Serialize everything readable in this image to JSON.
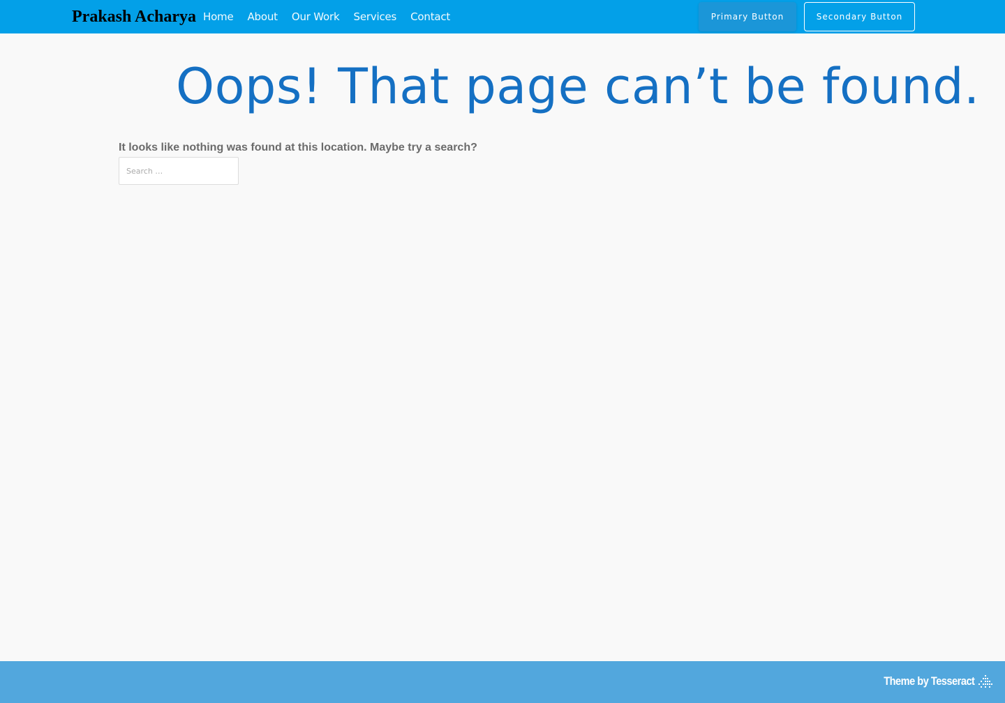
{
  "header": {
    "site_title": "Prakash Acharya",
    "nav": [
      "Home",
      "About",
      "Our Work",
      "Services",
      "Contact"
    ],
    "primary_button": "Primary Button",
    "secondary_button": "Secondary Button"
  },
  "main": {
    "heading": "Oops! That page can’t be found.",
    "message": "It looks like nothing was found at this location. Maybe try a search?",
    "search": {
      "placeholder": "Search …",
      "value": ""
    }
  },
  "footer": {
    "credit": "Theme by Tesseract",
    "icon": "tesseract-logo-icon"
  },
  "colors": {
    "header_bg": "#03a0e8",
    "heading": "#1570c3",
    "footer_bg": "#52a7dd",
    "page_bg": "#f9f9f9"
  }
}
